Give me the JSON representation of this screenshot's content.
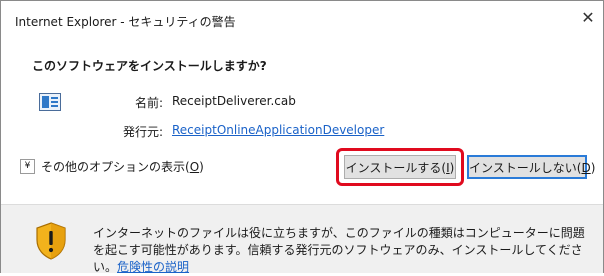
{
  "window": {
    "title": "Internet Explorer - セキュリティの警告",
    "close_glyph": "✕"
  },
  "dialog": {
    "heading": "このソフトウェアをインストールしますか?",
    "file_icon": "cab-file-icon",
    "name_label": "名前:",
    "name_value": "ReceiptDeliverer.cab",
    "publisher_label": "発行元:",
    "publisher_value": "ReceiptOnlineApplicationDeveloper"
  },
  "options": {
    "chevron_glyph": "¥",
    "label_text": "その他のオプションの表示(",
    "label_key": "O",
    "label_end": ")"
  },
  "buttons": {
    "install_text": "インストールする(",
    "install_key": "I",
    "install_end": ")",
    "noinstall_text": "インストールしない(",
    "noinstall_key": "D",
    "noinstall_end": ")"
  },
  "annotation": {
    "highlight_color": "#e00a1e",
    "target": "install-button"
  },
  "footer": {
    "icon": "warning-shield-icon",
    "warning_text": "インターネットのファイルは役に立ちますが、このファイルの種類はコンピューターに問題を起こす可能性があります。信頼する発行元のソフトウェアのみ、インストールしてください。",
    "risk_link": "危険性の説明"
  },
  "colors": {
    "link": "#1a62c8",
    "focus_border": "#2a7bd8",
    "footer_bg": "#f0f0f0"
  }
}
